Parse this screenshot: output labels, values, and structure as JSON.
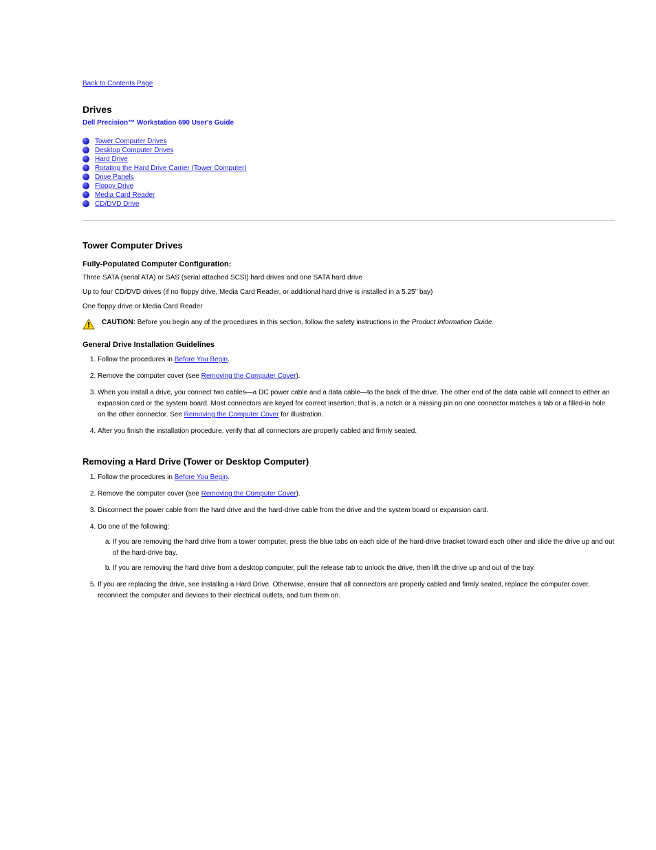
{
  "nav": {
    "back": "Back to Contents Page"
  },
  "header": {
    "title": "Drives",
    "subtitle": "Dell Precision™ Workstation 690 User's Guide"
  },
  "toc": {
    "items": [
      "Tower Computer Drives",
      "Desktop Computer Drives",
      "Hard Drive",
      "Rotating the Hard Drive Carrier (Tower Computer)",
      "Drive Panels",
      "Floppy Drive",
      "Media Card Reader",
      "CD/DVD Drive"
    ]
  },
  "section_tower": {
    "heading": "Tower Computer Drives",
    "config_heading": "Fully-Populated Computer Configuration:",
    "list_1": "Three SATA (serial ATA) or SAS (serial attached SCSI) hard drives and one SATA hard drive",
    "list_2": "Up to four CD/DVD drives (if no floppy drive, Media Card Reader, or additional hard drive is installed in a 5.25\" bay)",
    "list_3": "One floppy drive or Media Card Reader",
    "caution_label": "CAUTION:",
    "caution_text": " Before you begin any of the procedures in this section, follow the safety instructions in the",
    "caution_em": " Product Information Guide",
    "caution_after": ".",
    "general_heading": "General Drive Installation Guidelines",
    "ol_1_prefix": "Follow the procedures in ",
    "ol_1_link": "Before You Begin",
    "ol_1_after": ".",
    "ol_2_prefix": "Remove the computer cover (see ",
    "ol_2_link": "Removing the Computer Cover",
    "ol_2_after": ").",
    "ol_3_prefix": "When you install a drive, you connect two cables—a DC power cable and a data cable—to the back of the drive. The other end of the data cable will connect to either an expansion card or the system board. Most connectors are keyed for correct insertion; that is, a notch or a missing pin on one connector matches a tab or a filled-in hole on the other connector. See ",
    "ol_3_link": "Removing the Computer Cover",
    "ol_3_after": " for illustration.",
    "ol_4": "After you finish the installation procedure, verify that all connectors are properly cabled and firmly seated."
  },
  "section_remove_hd": {
    "heading": "Removing a Hard Drive (Tower or Desktop Computer)",
    "ol_1_prefix": "Follow the procedures in ",
    "ol_1_link": "Before You Begin",
    "ol_1_after": ".",
    "ol_2_prefix": "Remove the computer cover (see ",
    "ol_2_link": "Removing the Computer Cover",
    "ol_2_after": ").",
    "ol_3_text": "Disconnect the power cable from the hard drive and the hard-drive cable from the drive and the system board or expansion card.",
    "ol_4_prefix": "Do one of the following:",
    "ol_4_a": "If you are removing the hard drive from a tower computer, press the blue tabs on each side of the hard-drive bracket toward each other and slide the drive up and out of the hard-drive bay.",
    "ol_4_b": "If you are removing the hard drive from a desktop computer, pull the release tab to unlock the drive, then lift the drive up and out of the bay.",
    "ol_5": "If you are replacing the drive, see Installing a Hard Drive. Otherwise, ensure that all connectors are properly cabled and firmly seated, replace the computer cover, reconnect the computer and devices to their electrical outlets, and turn them on."
  }
}
